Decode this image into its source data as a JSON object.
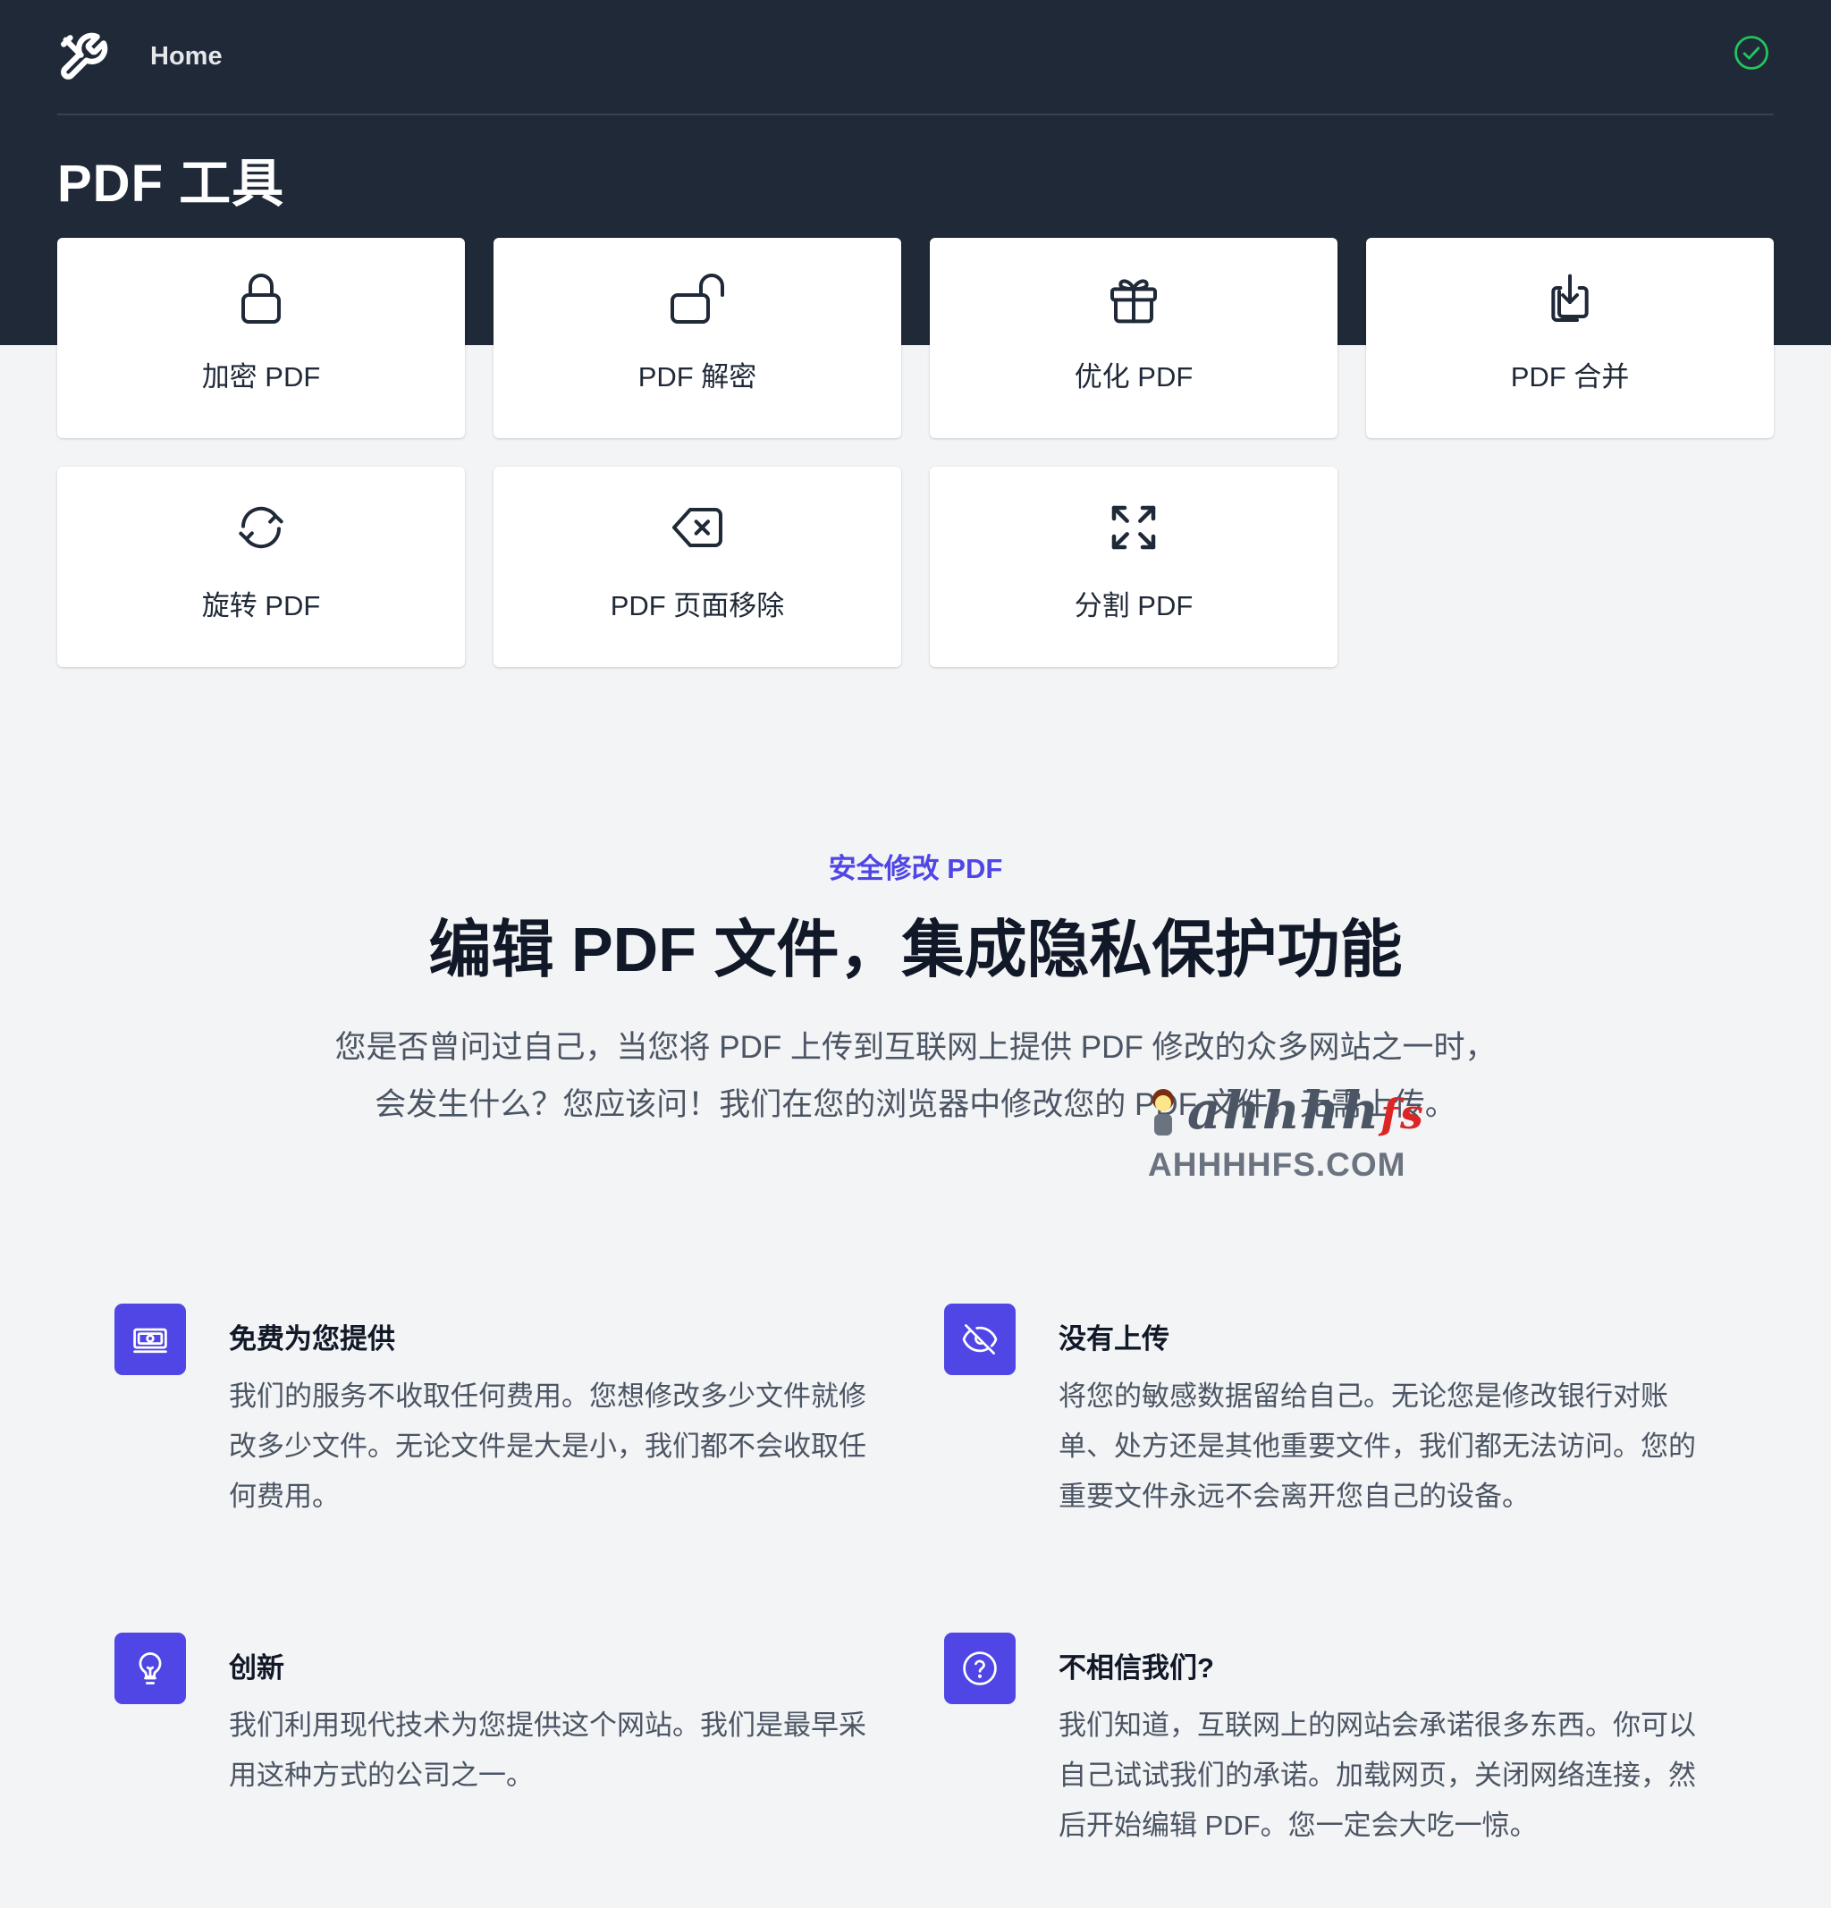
{
  "nav": {
    "home": "Home"
  },
  "page_title": "PDF 工具",
  "tools": [
    {
      "label": "加密 PDF",
      "icon": "lock-icon"
    },
    {
      "label": "PDF 解密",
      "icon": "unlock-icon"
    },
    {
      "label": "优化 PDF",
      "icon": "gift-icon"
    },
    {
      "label": "PDF 合并",
      "icon": "merge-download-icon"
    },
    {
      "label": "旋转 PDF",
      "icon": "rotate-icon"
    },
    {
      "label": "PDF 页面移除",
      "icon": "backspace-delete-icon"
    },
    {
      "label": "分割 PDF",
      "icon": "expand-arrows-icon"
    }
  ],
  "features_section": {
    "eyebrow": "安全修改 PDF",
    "headline": "编辑 PDF 文件，集成隐私保护功能",
    "intro_line1": "您是否曾问过自己，当您将 PDF 上传到互联网上提供 PDF 修改的众多网站之一时，",
    "intro_line2": "会发生什么？您应该问！我们在您的浏览器中修改您的 PDF 文件，无需上传。"
  },
  "features": [
    {
      "title": "免费为您提供",
      "body": "我们的服务不收取任何费用。您想修改多少文件就修改多少文件。无论文件是大是小，我们都不会收取任何费用。",
      "icon": "money-icon"
    },
    {
      "title": "没有上传",
      "body": "将您的敏感数据留给自己。无论您是修改银行对账单、处方还是其他重要文件，我们都无法访问。您的重要文件永远不会离开您自己的设备。",
      "icon": "eye-off-icon"
    },
    {
      "title": "创新",
      "body": "我们利用现代技术为您提供这个网站。我们是最早采用这种方式的公司之一。",
      "icon": "lightbulb-icon"
    },
    {
      "title": "不相信我们?",
      "body": "我们知道，互联网上的网站会承诺很多东西。你可以自己试试我们的承诺。加载网页，关闭网络连接，然后开始编辑 PDF。您一定会大吃一惊。",
      "icon": "question-circle-icon"
    }
  ],
  "watermark": {
    "script": "ahhhhfs",
    "domain": "AHHHHFS.COM"
  },
  "colors": {
    "header_bg": "#1f2937",
    "accent": "#4f46e5",
    "status_ok": "#22c55e",
    "page_bg": "#f3f4f6"
  }
}
